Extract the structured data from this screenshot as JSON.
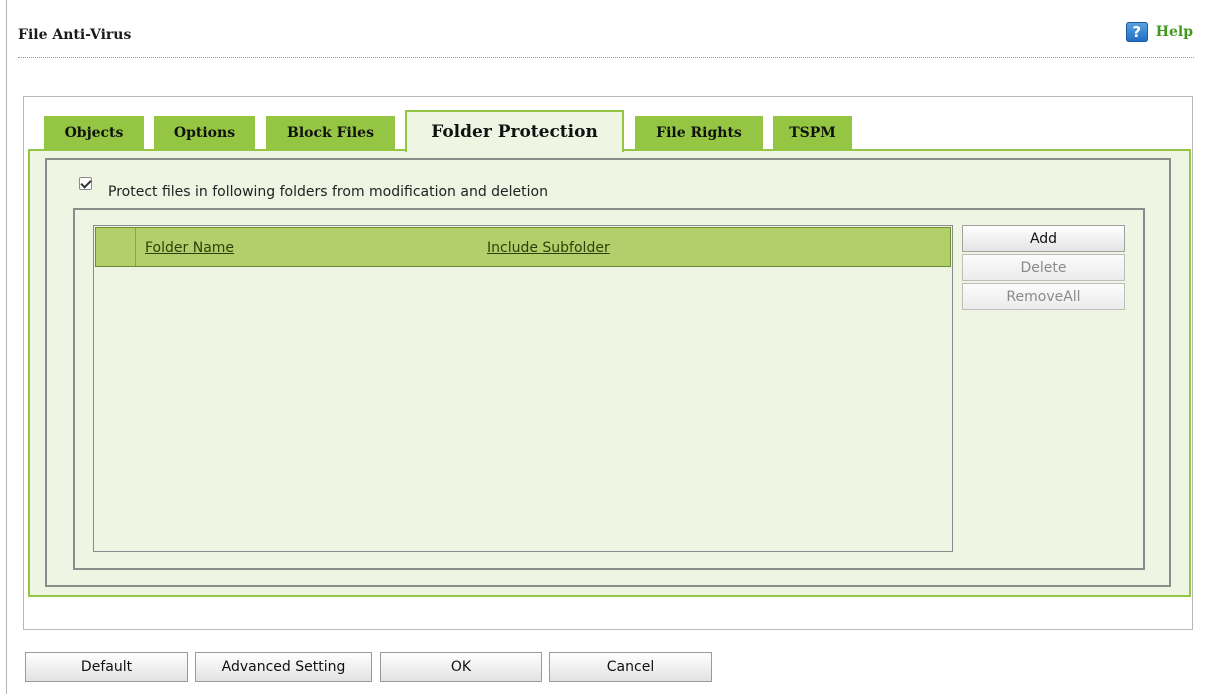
{
  "header": {
    "title": "File Anti-Virus",
    "help_label": "Help",
    "help_icon": "?"
  },
  "tabs": [
    {
      "label": "Objects"
    },
    {
      "label": "Options"
    },
    {
      "label": "Block Files"
    },
    {
      "label": "Folder Protection",
      "active": true
    },
    {
      "label": "File Rights"
    },
    {
      "label": "TSPM"
    }
  ],
  "folder_protection": {
    "protect_checkbox": {
      "label": "Protect files in following folders from modification and deletion",
      "checked": true
    },
    "table": {
      "columns": [
        "Folder Name",
        "Include Subfolder"
      ],
      "rows": []
    },
    "buttons": {
      "add": "Add",
      "delete": "Delete",
      "remove_all": "RemoveAll"
    }
  },
  "footer": {
    "default": "Default",
    "advanced": "Advanced Setting",
    "ok": "OK",
    "cancel": "Cancel"
  },
  "colors": {
    "tab_green": "#94c643",
    "panel_bg": "#eef5e2",
    "header_green": "#b1d06b",
    "help_text": "#3f9a1b"
  }
}
